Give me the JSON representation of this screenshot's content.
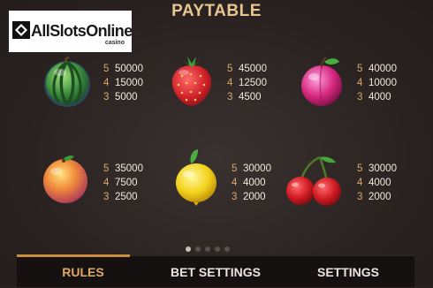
{
  "logo": {
    "text": "AllSlotsOnline",
    "sub": "casino"
  },
  "title": "PAYTABLE",
  "symbols": [
    {
      "name": "watermelon",
      "pays": [
        {
          "count": "5",
          "value": "50000"
        },
        {
          "count": "4",
          "value": "15000"
        },
        {
          "count": "3",
          "value": "5000"
        }
      ]
    },
    {
      "name": "strawberry",
      "pays": [
        {
          "count": "5",
          "value": "45000"
        },
        {
          "count": "4",
          "value": "12500"
        },
        {
          "count": "3",
          "value": "4500"
        }
      ]
    },
    {
      "name": "plum",
      "pays": [
        {
          "count": "5",
          "value": "40000"
        },
        {
          "count": "4",
          "value": "10000"
        },
        {
          "count": "3",
          "value": "4000"
        }
      ]
    },
    {
      "name": "orange",
      "pays": [
        {
          "count": "5",
          "value": "35000"
        },
        {
          "count": "4",
          "value": "7500"
        },
        {
          "count": "3",
          "value": "2500"
        }
      ]
    },
    {
      "name": "lemon",
      "pays": [
        {
          "count": "5",
          "value": "30000"
        },
        {
          "count": "4",
          "value": "4000"
        },
        {
          "count": "3",
          "value": "2000"
        }
      ]
    },
    {
      "name": "cherries",
      "pays": [
        {
          "count": "5",
          "value": "30000"
        },
        {
          "count": "4",
          "value": "4000"
        },
        {
          "count": "3",
          "value": "2000"
        }
      ]
    }
  ],
  "pagination": {
    "pages": 5,
    "current": 1
  },
  "tabs": [
    {
      "label": "RULES",
      "active": true
    },
    {
      "label": "BET SETTINGS",
      "active": false
    },
    {
      "label": "SETTINGS",
      "active": false
    }
  ],
  "colors": {
    "title": "#e8c48e",
    "count": "#d9a96a",
    "value": "#f2e8da",
    "active_tab": "#e0ab62",
    "indicator": "#c98f3f"
  }
}
